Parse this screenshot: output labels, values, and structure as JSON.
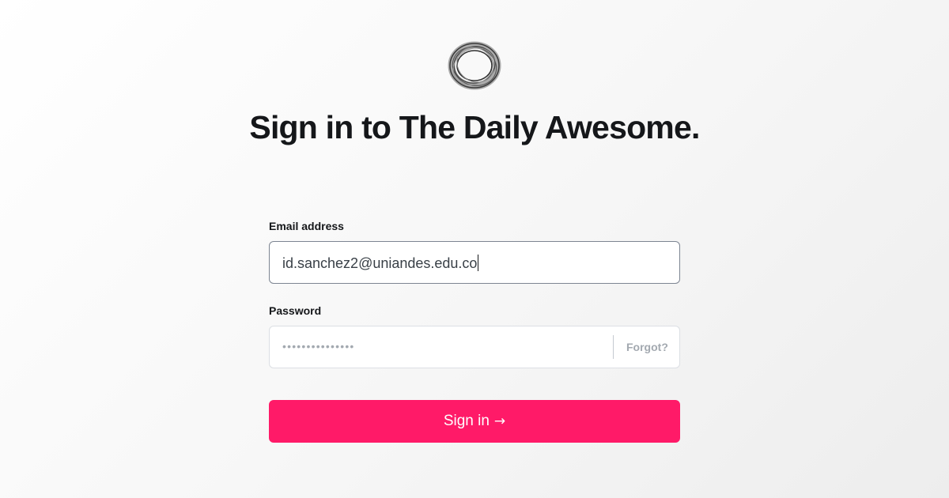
{
  "page": {
    "title": "Sign in to The Daily Awesome."
  },
  "form": {
    "email_label": "Email address",
    "email_value": "id.sanchez2@uniandes.edu.co",
    "password_label": "Password",
    "password_mask": "•••••••••••••••",
    "forgot_label": "Forgot?",
    "submit_label": "Sign in",
    "submit_arrow": "→"
  },
  "icons": {
    "logo": "ring-logo-icon",
    "submit": "arrow-right-icon"
  },
  "colors": {
    "accent": "#ff1a68",
    "text": "#15171a",
    "muted": "#a3a9b0"
  }
}
